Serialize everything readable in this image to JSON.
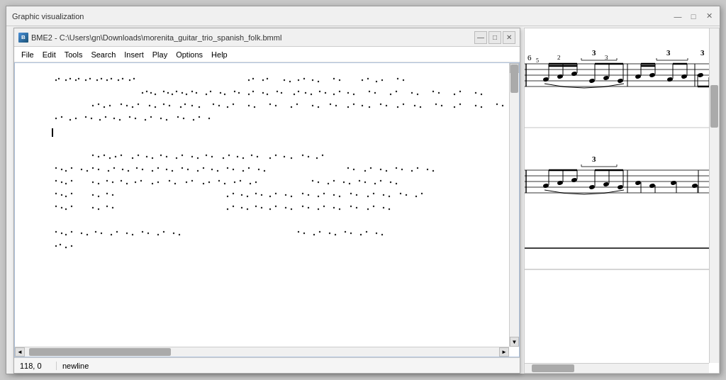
{
  "graphic_window": {
    "title": "Graphic visualization",
    "controls": [
      "—",
      "□",
      "✕"
    ]
  },
  "bme2_window": {
    "title": "BME2 - C:\\Users\\gn\\Downloads\\morenita_guitar_trio_spanish_folk.bmml",
    "icon_label": "B",
    "controls": [
      "—",
      "□",
      "✕"
    ],
    "menu": [
      "File",
      "Edit",
      "Tools",
      "Search",
      "Insert",
      "Play",
      "Options",
      "Help"
    ]
  },
  "status": {
    "position": "118, 0",
    "text": "newline"
  },
  "scrollbar": {
    "up_arrow": "▲",
    "down_arrow": "▼",
    "left_arrow": "◄",
    "right_arrow": "►"
  }
}
